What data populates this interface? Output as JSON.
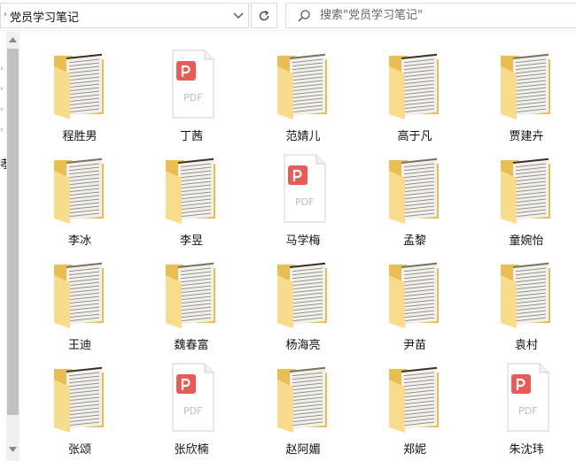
{
  "addressbar": {
    "path": "党员学习笔记"
  },
  "search": {
    "placeholder": "搜索\"党员学习笔记\""
  },
  "items": [
    {
      "name": "程胜男",
      "type": "folder"
    },
    {
      "name": "丁茜",
      "type": "pdf"
    },
    {
      "name": "范婧儿",
      "type": "folder"
    },
    {
      "name": "高于凡",
      "type": "folder"
    },
    {
      "name": "贾建卉",
      "type": "folder"
    },
    {
      "name": "李冰",
      "type": "folder"
    },
    {
      "name": "李昱",
      "type": "folder"
    },
    {
      "name": "马学梅",
      "type": "pdf"
    },
    {
      "name": "孟黎",
      "type": "folder"
    },
    {
      "name": "童婉怡",
      "type": "folder"
    },
    {
      "name": "王迪",
      "type": "folder"
    },
    {
      "name": "魏春富",
      "type": "folder"
    },
    {
      "name": "杨海亮",
      "type": "folder"
    },
    {
      "name": "尹苗",
      "type": "folder"
    },
    {
      "name": "袁村",
      "type": "folder"
    },
    {
      "name": "张颂",
      "type": "folder"
    },
    {
      "name": "张欣楠",
      "type": "pdf"
    },
    {
      "name": "赵阿媚",
      "type": "folder"
    },
    {
      "name": "郑妮",
      "type": "folder"
    },
    {
      "name": "朱沈玮",
      "type": "pdf"
    }
  ],
  "pdf_label": "PDF",
  "colors": {
    "folder": "#f6d77c",
    "folder_dark": "#e9bd52",
    "pdf_badge": "#e95b57"
  },
  "nav_glyph": "孝"
}
